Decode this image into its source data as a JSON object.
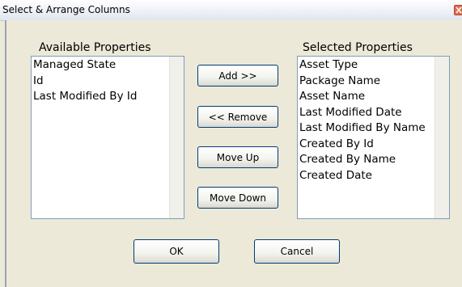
{
  "window": {
    "title": "Select & Arrange Columns"
  },
  "available": {
    "heading": "Available Properties",
    "items": [
      "Managed State",
      "Id",
      "Last Modified By Id"
    ]
  },
  "selected": {
    "heading": "Selected Properties",
    "items": [
      "Asset Type",
      "Package Name",
      "Asset Name",
      "Last Modified Date",
      "Last Modified By Name",
      "Created By Id",
      "Created By Name",
      "Created Date"
    ]
  },
  "buttons": {
    "add": "Add >>",
    "remove": "<< Remove",
    "move_up": "Move Up",
    "move_down": "Move Down",
    "ok": "OK",
    "cancel": "Cancel"
  },
  "colors": {
    "dialog_bg": "#ece9d8",
    "button_border": "#003c74",
    "listbox_border": "#7f9db9",
    "close_button": "#e06a4c"
  },
  "icons": {
    "close": "close-icon"
  }
}
